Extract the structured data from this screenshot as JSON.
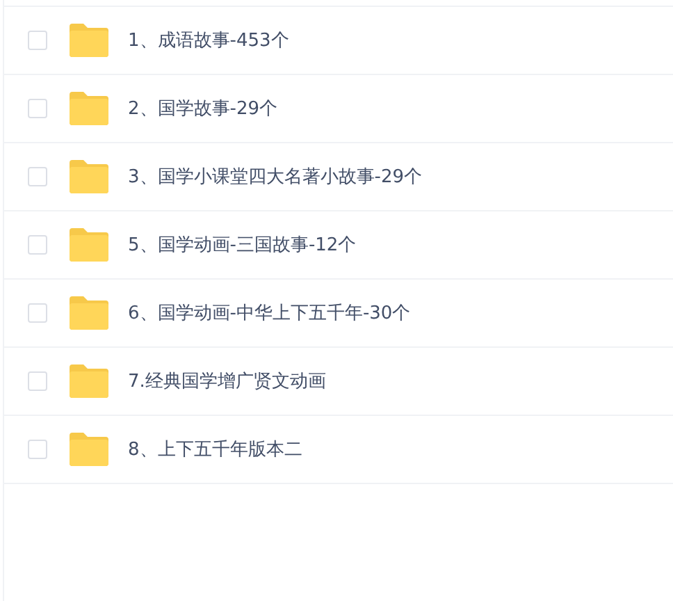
{
  "files": [
    {
      "name": "1、成语故事-453个",
      "checked": false
    },
    {
      "name": "2、国学故事-29个",
      "checked": false
    },
    {
      "name": "3、国学小课堂四大名著小故事-29个",
      "checked": false
    },
    {
      "name": "5、国学动画-三国故事-12个",
      "checked": false
    },
    {
      "name": "6、国学动画-中华上下五千年-30个",
      "checked": false
    },
    {
      "name": "7.经典国学增广贤文动画",
      "checked": false
    },
    {
      "name": "8、上下五千年版本二",
      "checked": false
    }
  ]
}
